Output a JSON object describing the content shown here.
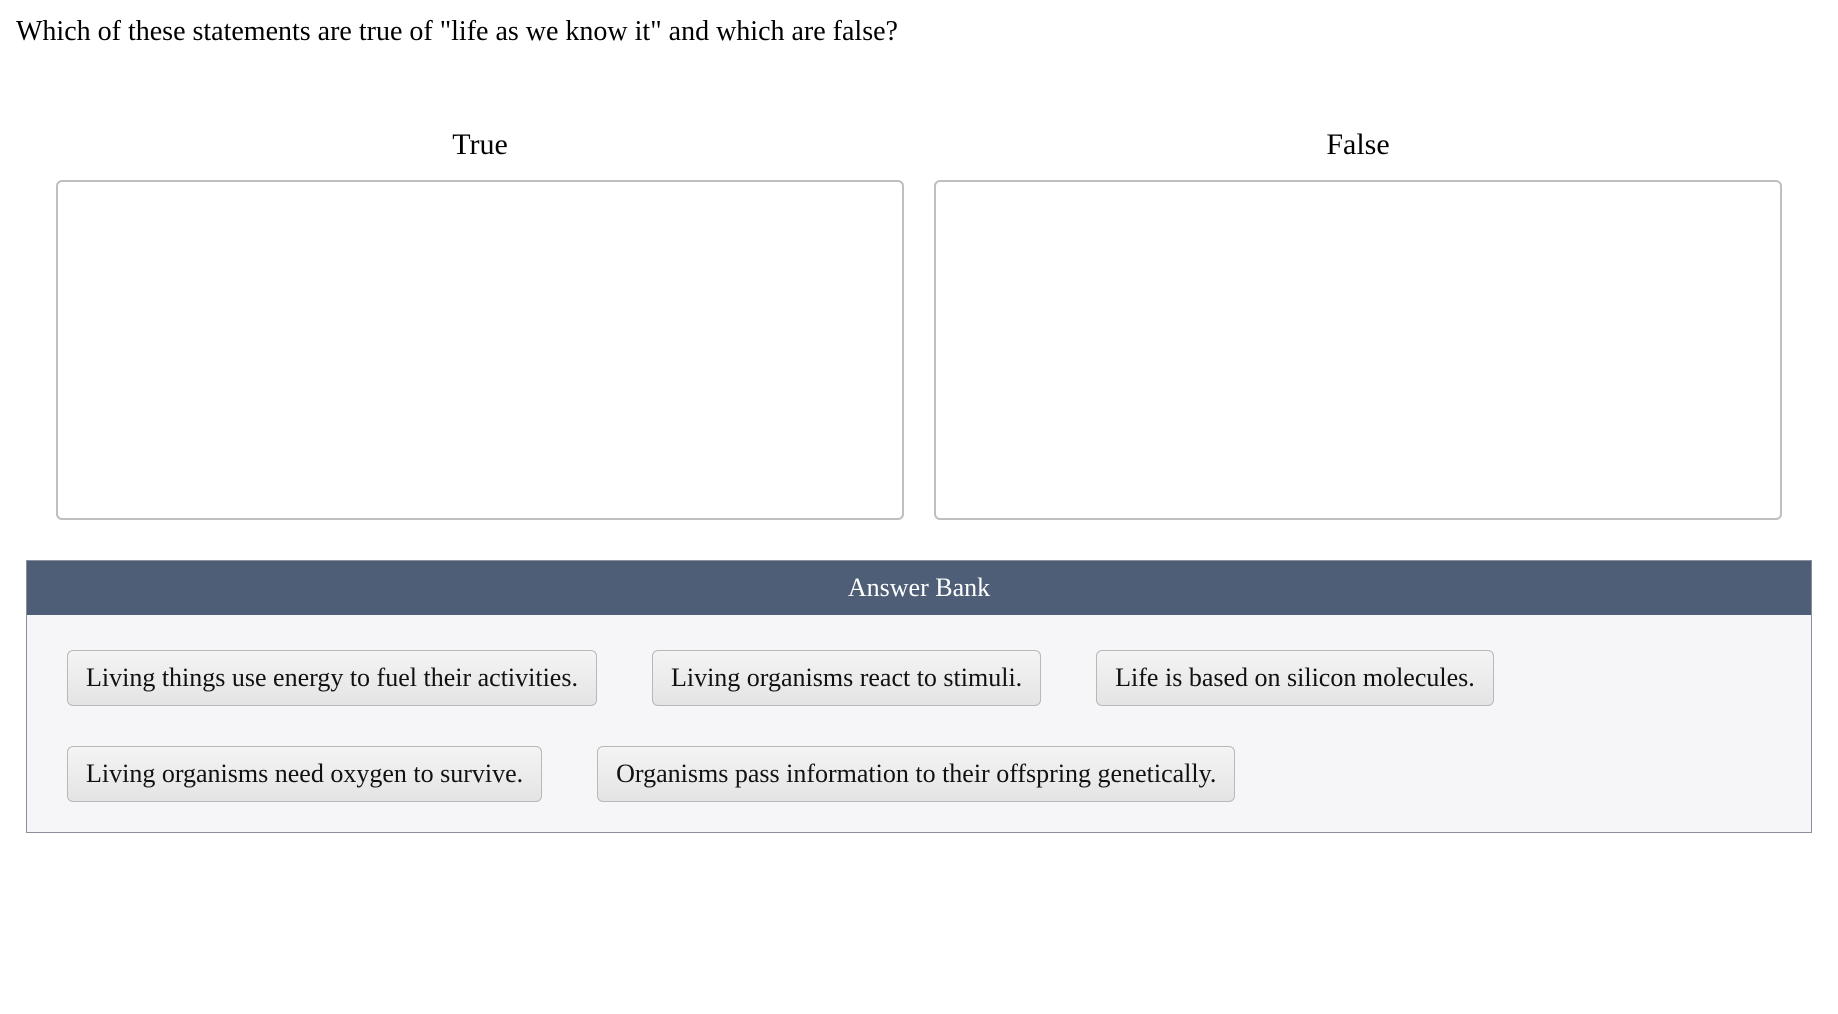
{
  "question": "Which of these statements are true of \"life as we know it\" and which are false?",
  "zones": {
    "true_label": "True",
    "false_label": "False"
  },
  "answer_bank": {
    "header": "Answer Bank",
    "items": [
      "Living things use energy to fuel their activities.",
      "Living organisms react to stimuli.",
      "Life is based on silicon molecules.",
      "Living organisms need oxygen to survive.",
      "Organisms pass information to their offspring genetically."
    ]
  }
}
